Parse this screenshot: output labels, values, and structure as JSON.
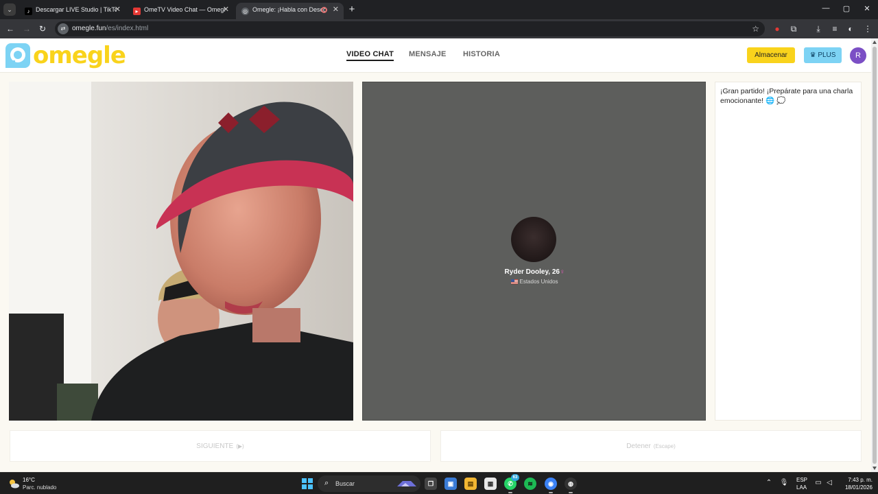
{
  "browser": {
    "tabs": [
      {
        "title": "Descargar LIVE Studio | TikTok",
        "favicon": "tiktok-icon",
        "active": false
      },
      {
        "title": "OmeTV Video Chat — Omegle",
        "favicon": "ometv-icon",
        "active": false
      },
      {
        "title": "Omegle: ¡Habla con Desconocidos!",
        "favicon": "globe-icon",
        "active": true,
        "recording": true
      }
    ],
    "url_domain": "omegle.fun",
    "url_path": "/es/index.html"
  },
  "site": {
    "logo_text": "omegle",
    "nav": [
      {
        "label": "VIDEO CHAT",
        "active": true
      },
      {
        "label": "MENSAJE",
        "active": false
      },
      {
        "label": "HISTORIA",
        "active": false
      }
    ],
    "store_label": "Almacenar",
    "plus_label": "PLUS",
    "avatar_initial": "R"
  },
  "stranger": {
    "name": "Ryder Dooley, 26",
    "gender_symbol": "♀",
    "country": "Estados Unidos"
  },
  "chat": {
    "message": "¡Gran partido! ¡Prepárate para una charla emocionante! 🌐 💭"
  },
  "controls": {
    "next_label": "SIGUIENTE",
    "next_hint": "(▶)",
    "stop_label": "Detener",
    "stop_hint": "(Escape)"
  },
  "taskbar": {
    "temperature": "16°C",
    "weather": "Parc. nublado",
    "search_label": "Buscar",
    "whatsapp_badge": "63",
    "language": "ESP",
    "layout": "LAA",
    "time": "7:43 p. m.",
    "date": "18/01/2026"
  },
  "colors": {
    "brand_yellow": "#f9d31c",
    "brand_blue": "#7dd3f4",
    "remote_bg": "#5d5e5c",
    "avatar_purple": "#7b4fc5"
  }
}
